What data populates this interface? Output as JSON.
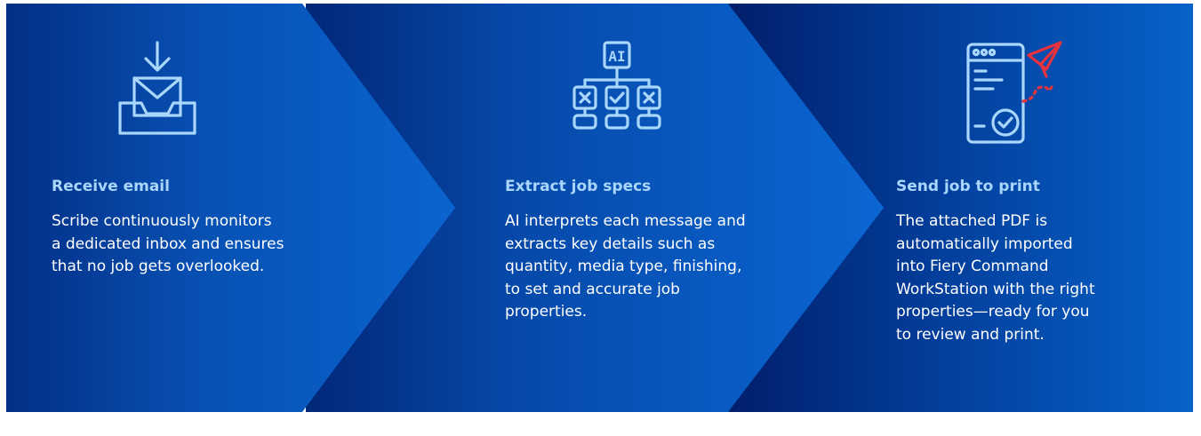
{
  "steps": [
    {
      "icon": "inbox-download-icon",
      "title": "Receive email",
      "lines": [
        "Scribe continuously monitors",
        "a dedicated inbox and ensures",
        "that no job gets overlooked."
      ]
    },
    {
      "icon": "ai-flowchart-icon",
      "title": "Extract job specs",
      "lines": [
        "AI interprets each message and",
        "extracts key details such as",
        "quantity, media type, finishing,",
        "to set and accurate job",
        "properties."
      ]
    },
    {
      "icon": "document-paper-plane-icon",
      "title": "Send job to print",
      "lines": [
        "The attached PDF is",
        "automatically imported",
        "into Fiery Command",
        "WorkStation with the right",
        "properties—ready for you",
        "to review and print."
      ]
    }
  ],
  "icon_text": {
    "ai_label": "AI"
  },
  "colors": {
    "title": "#a9d6fb",
    "body_text": "#ffffff",
    "icon_stroke": "#a9d6fb",
    "accent_red": "#e8323c"
  }
}
